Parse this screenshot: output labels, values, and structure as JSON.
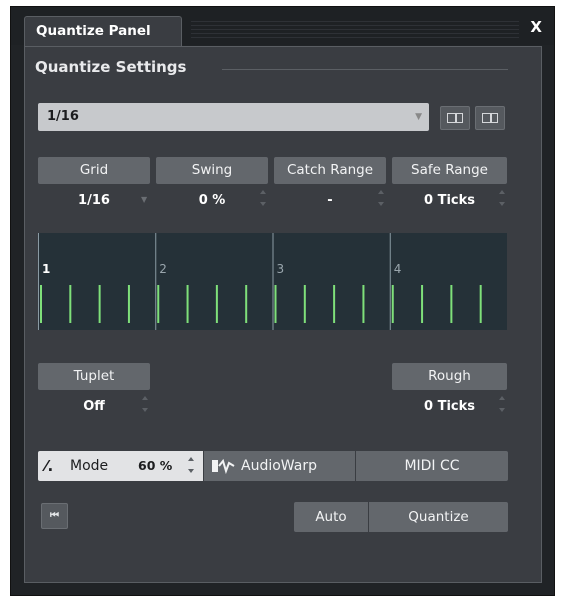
{
  "window": {
    "tab_title": "Quantize Panel",
    "close_label": "X"
  },
  "settings": {
    "section_title": "Quantize Settings",
    "preset_value": "1/16"
  },
  "params": {
    "grid": {
      "label": "Grid",
      "value": "1/16"
    },
    "swing": {
      "label": "Swing",
      "value": "0 %"
    },
    "catch_range": {
      "label": "Catch Range",
      "value": "-"
    },
    "safe_range": {
      "label": "Safe Range",
      "value": "0 Ticks"
    }
  },
  "grid_display": {
    "bar_labels": [
      "1",
      "2",
      "3",
      "4"
    ]
  },
  "tuplet": {
    "label": "Tuplet",
    "value": "Off"
  },
  "rough": {
    "label": "Rough",
    "value": "0 Ticks"
  },
  "mode": {
    "icon_text": "⁄/.",
    "label": "Mode",
    "value": "60 %"
  },
  "audiowarp_label": "AudioWarp",
  "midicc_label": "MIDI CC",
  "auto_label": "Auto",
  "quantize_label": "Quantize",
  "icons": {
    "close": "close-icon",
    "preset_dropdown": "chevron-down-icon",
    "save_preset": "save-preset-icon",
    "remove_preset": "remove-preset-icon",
    "audiowarp": "audiowarp-icon",
    "reset": "reset-icon"
  },
  "colors": {
    "window_bg": "#202326",
    "panel_bg": "#3a3d42",
    "button_bg": "#63676c",
    "grid_bg": "#253138",
    "grid_tick": "#7fe07a"
  }
}
